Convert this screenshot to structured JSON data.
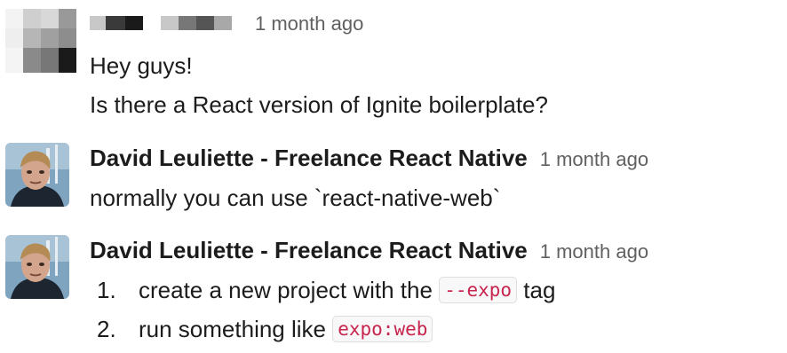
{
  "messages": [
    {
      "author": "",
      "author_redacted": true,
      "timestamp": "1 month ago",
      "lines": [
        "Hey guys!",
        "Is there a React version of Ignite boilerplate?"
      ]
    },
    {
      "author": "David Leuliette - Freelance React Native",
      "timestamp": "1 month ago",
      "text": "normally you can use `react-native-web`"
    },
    {
      "author": "David Leuliette - Freelance React Native",
      "timestamp": "1 month ago",
      "list": [
        {
          "number": "1.",
          "before": "create a new project with the",
          "code": "--expo",
          "after": "tag"
        },
        {
          "number": "2.",
          "before": "run something like",
          "code": "expo:web",
          "after": ""
        }
      ]
    }
  ],
  "colors": {
    "author": "#1d1c1d",
    "timestamp": "#616061",
    "code_text": "#c7254e",
    "code_bg": "#f8f8f8"
  },
  "icons": {
    "message_1_avatar": "pixelated-avatar",
    "message_2_avatar": "user-photo-avatar",
    "message_3_avatar": "user-photo-avatar"
  }
}
